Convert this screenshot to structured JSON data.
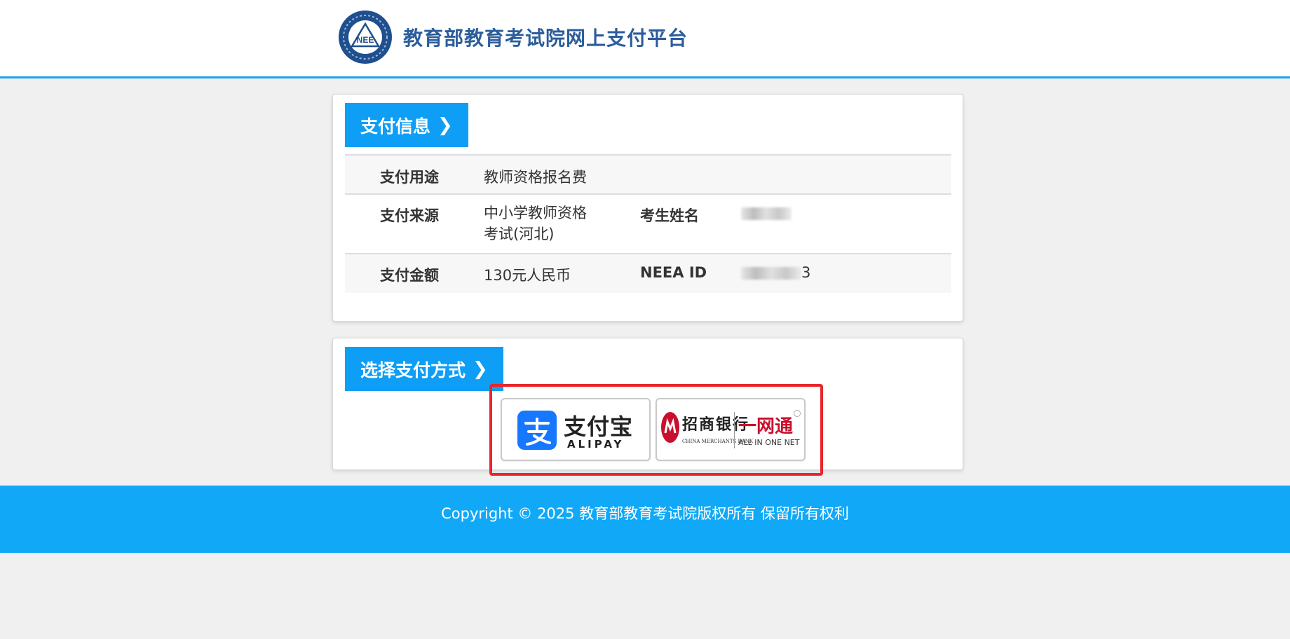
{
  "header": {
    "site_title": "教育部教育考试院网上支付平台",
    "logo_icon": "neea-emblem-icon",
    "logo_text": "NEE"
  },
  "payment_info": {
    "section_title": "支付信息",
    "purpose_label": "支付用途",
    "purpose_value": "教师资格报名费",
    "source_label": "支付来源",
    "source_value": "中小学教师资格考试(河北)",
    "name_label": "考生姓名",
    "amount_label": "支付金额",
    "amount_value": "130元人民币",
    "id_label": "NEEA ID",
    "id_visible_suffix": "3"
  },
  "payment_method": {
    "section_title": "选择支付方式",
    "alipay": {
      "cn": "支付宝",
      "en": "ALIPAY",
      "icon": "alipay-icon",
      "brand_color": "#1677ff"
    },
    "cmb": {
      "cn": "招商银行",
      "en": "CHINA MERCHANTS BANK",
      "net_cn": "一网通",
      "net_en": "ALL IN ONE NET",
      "icon": "cmb-logo-icon",
      "brand_color": "#c8102e"
    }
  },
  "footer": {
    "text": "Copyright © 2025 教育部教育考试院版权所有 保留所有权利"
  },
  "colors": {
    "accent": "#0e9ef5",
    "footer": "#11a9f7",
    "highlight": "#e8262b",
    "title": "#2b5d9c"
  }
}
